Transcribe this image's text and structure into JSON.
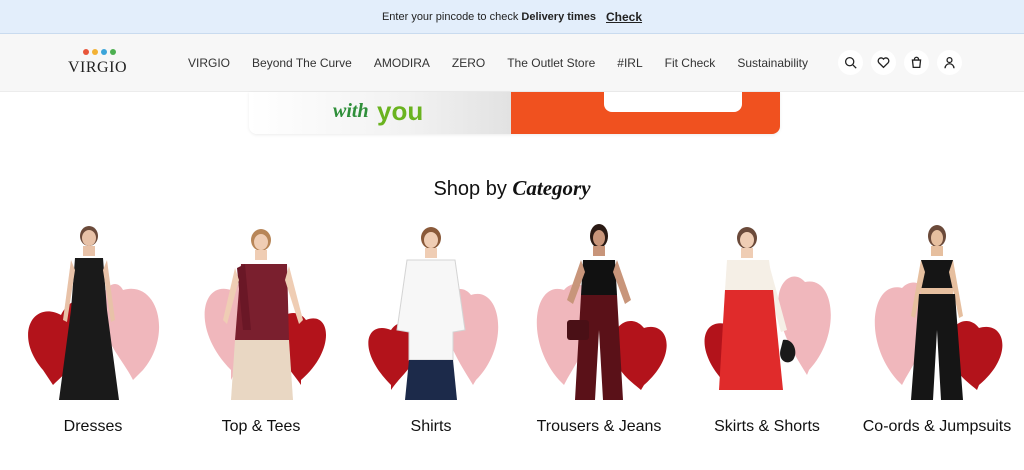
{
  "topbar": {
    "message_prefix": "Enter your pincode to check",
    "message_bold": "Delivery times",
    "check_label": "Check"
  },
  "header": {
    "logo_text": "VIRGIO",
    "logo_dot_colors": [
      "#e8553a",
      "#f2b134",
      "#3ba4d9",
      "#4caf50"
    ],
    "nav": [
      {
        "label": "VIRGIO"
      },
      {
        "label": "Beyond The Curve"
      },
      {
        "label": "AMODIRA"
      },
      {
        "label": "ZERO"
      },
      {
        "label": "The Outlet Store"
      },
      {
        "label": "#IRL"
      },
      {
        "label": "Fit Check"
      },
      {
        "label": "Sustainability"
      }
    ],
    "icons": [
      "search-icon",
      "heart-icon",
      "bag-icon",
      "user-icon"
    ]
  },
  "banner": {
    "with_text": "with",
    "you_text": "you",
    "accent_color": "#f0511f"
  },
  "section": {
    "title_plain": "Shop by",
    "title_accent": "Category"
  },
  "categories": [
    {
      "label": "Dresses",
      "heart_colors": [
        "#b3131b",
        "#f0b7bc"
      ]
    },
    {
      "label": "Top & Tees",
      "heart_colors": [
        "#f0b7bc",
        "#b3131b"
      ]
    },
    {
      "label": "Shirts",
      "heart_colors": [
        "#b3131b",
        "#f0b7bc"
      ]
    },
    {
      "label": "Trousers & Jeans",
      "heart_colors": [
        "#f0b7bc",
        "#b3131b"
      ]
    },
    {
      "label": "Skirts & Shorts",
      "heart_colors": [
        "#b3131b",
        "#f0b7bc"
      ]
    },
    {
      "label": "Co-ords & Jumpsuits",
      "heart_colors": [
        "#f0b7bc",
        "#b3131b"
      ]
    }
  ]
}
